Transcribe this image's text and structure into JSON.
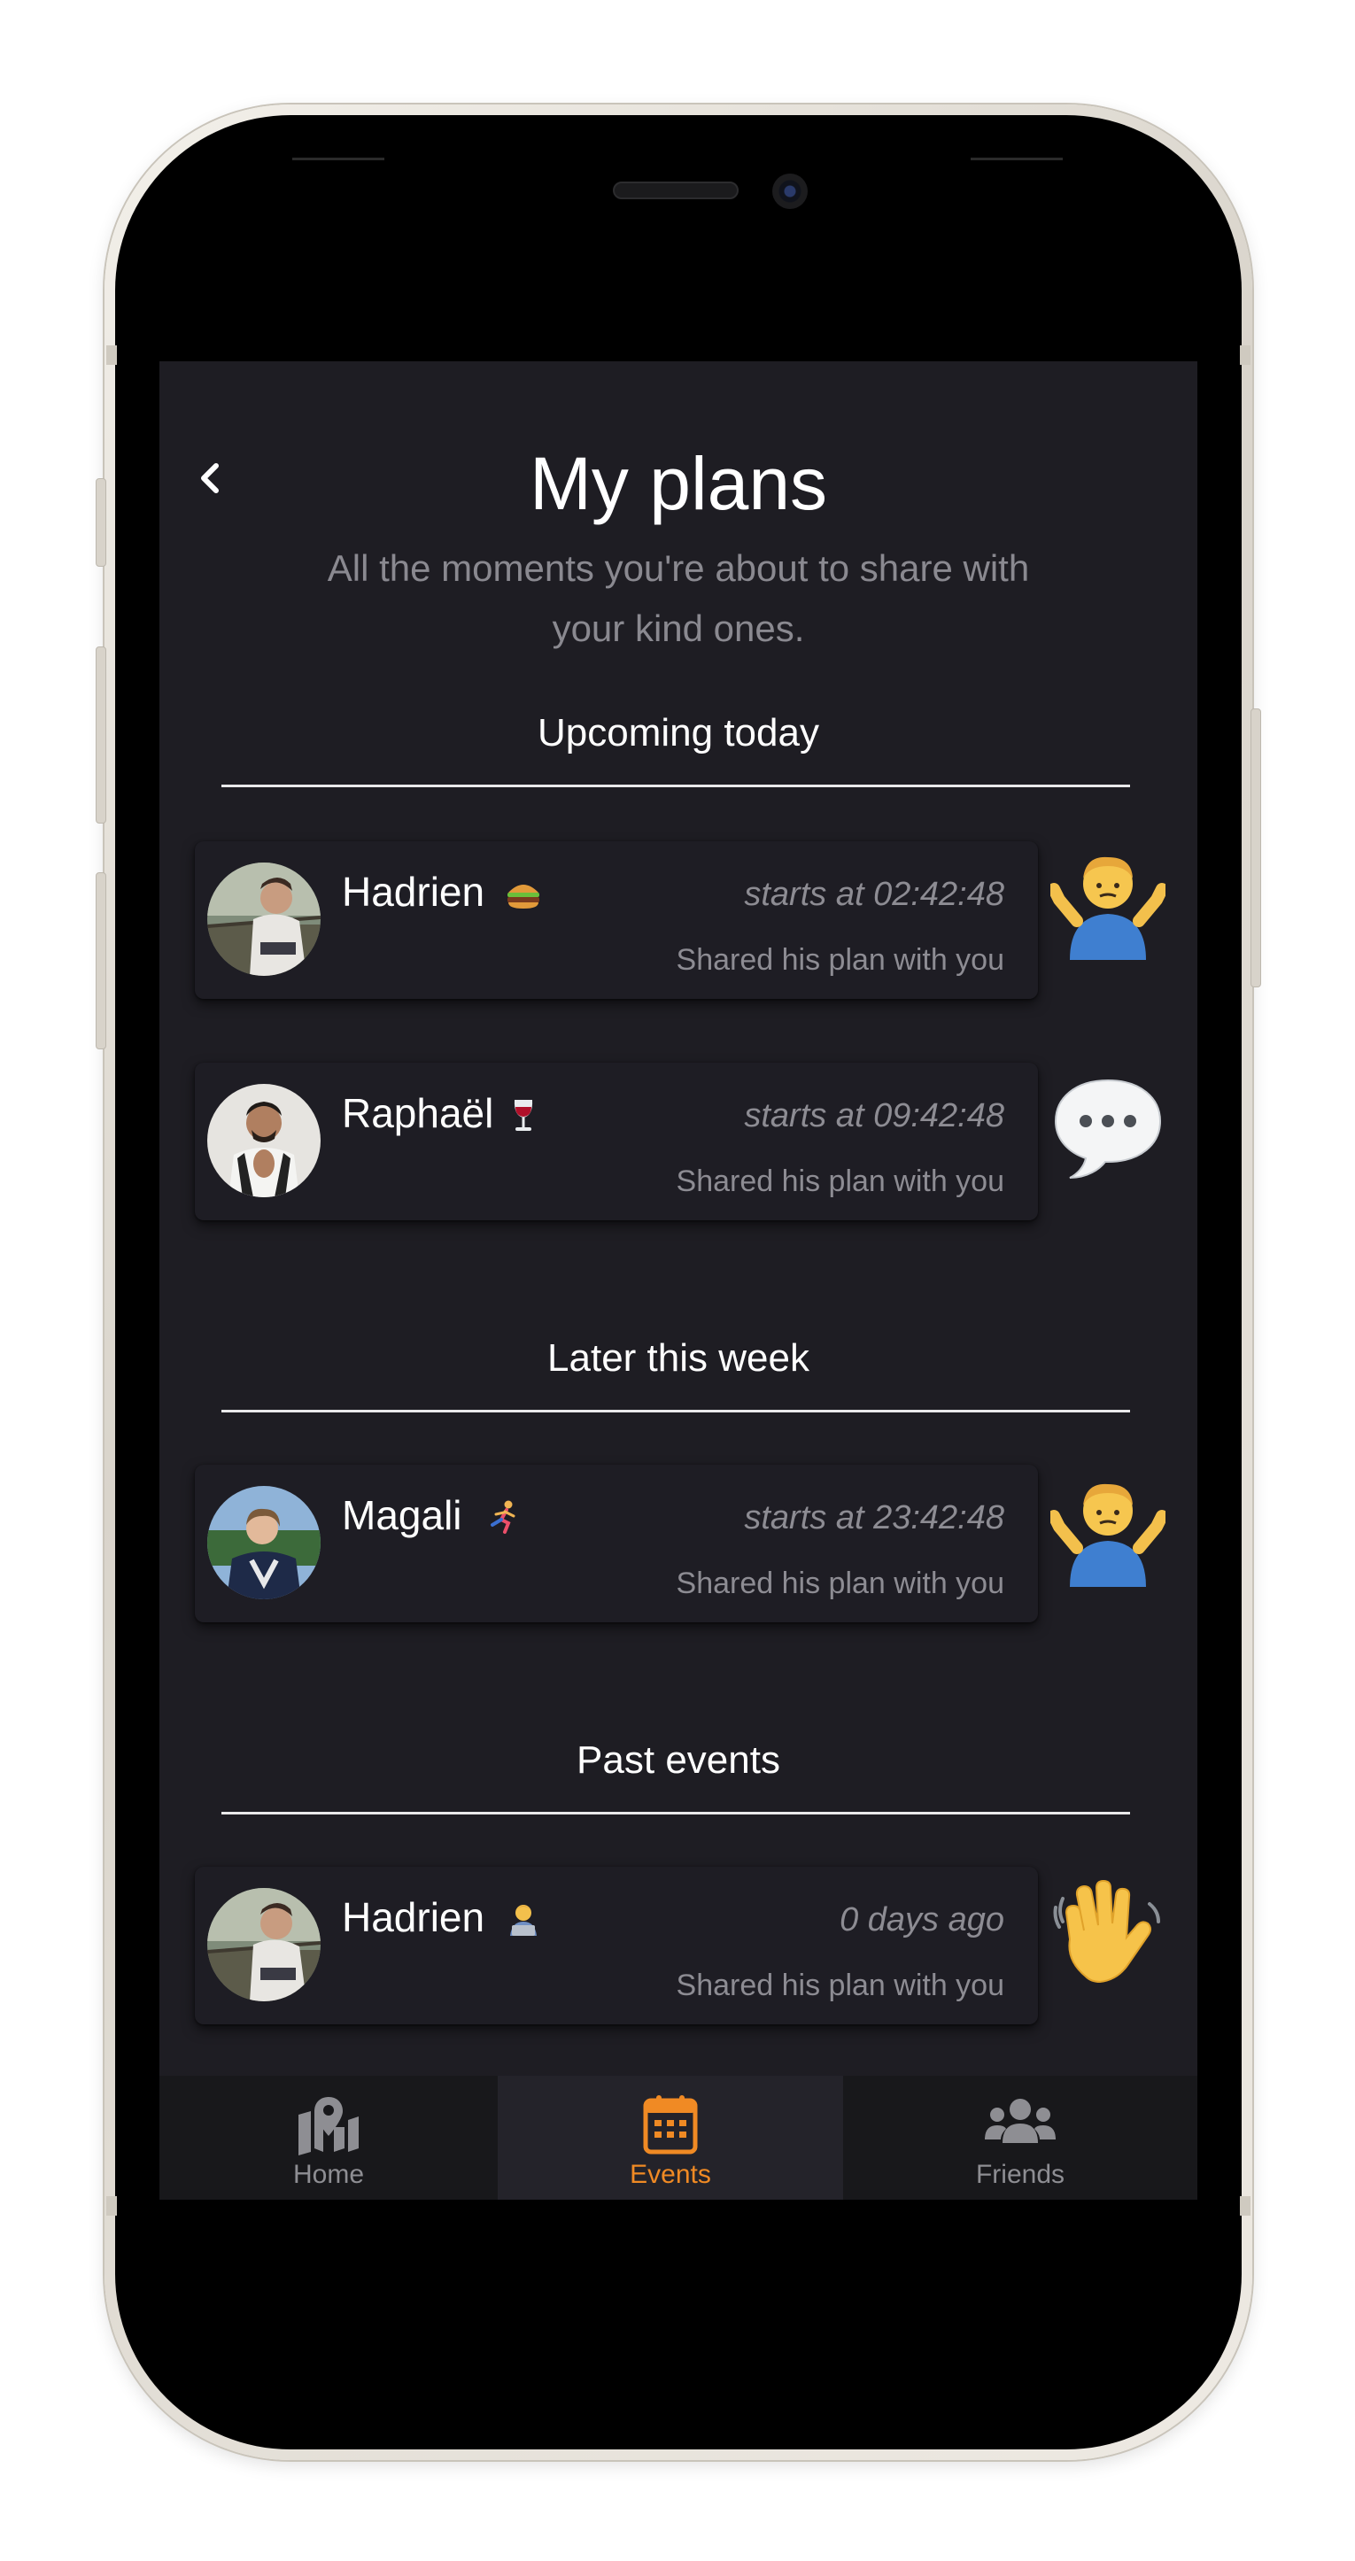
{
  "header": {
    "title": "My plans",
    "subtitle_line1": "All the moments you're about to share with",
    "subtitle_line2": "your kind ones."
  },
  "sections": [
    {
      "title": "Upcoming today",
      "cards": [
        {
          "name": "Hadrien",
          "emoji": "burger-emoji",
          "time": "starts at 02:42:48",
          "note": "Shared his plan with you",
          "reaction": "person-shrugging-emoji"
        },
        {
          "name": "Raphaël",
          "emoji": "wine-glass-emoji",
          "time": "starts at 09:42:48",
          "note": "Shared his plan with you",
          "reaction": "speech-bubble-emoji"
        }
      ]
    },
    {
      "title": "Later this week",
      "cards": [
        {
          "name": "Magali",
          "emoji": "person-running-emoji",
          "time": "starts at 23:42:48",
          "note": "Shared his plan with you",
          "reaction": "person-shrugging-emoji"
        }
      ]
    },
    {
      "title": "Past events",
      "cards": [
        {
          "name": "Hadrien",
          "emoji": "technologist-emoji",
          "time": "0 days ago",
          "note": "Shared his plan with you",
          "reaction": "waving-hand-emoji"
        }
      ]
    }
  ],
  "tabbar": {
    "items": [
      {
        "label": "Home",
        "icon": "map-marker-icon",
        "active": false
      },
      {
        "label": "Events",
        "icon": "calendar-icon",
        "active": true
      },
      {
        "label": "Friends",
        "icon": "users-icon",
        "active": false
      }
    ]
  },
  "colors": {
    "screen_bg": "#1e1d23",
    "accent": "#f08a24",
    "inactive_tab": "#8e8e93",
    "muted_text": "#8d8c93"
  }
}
